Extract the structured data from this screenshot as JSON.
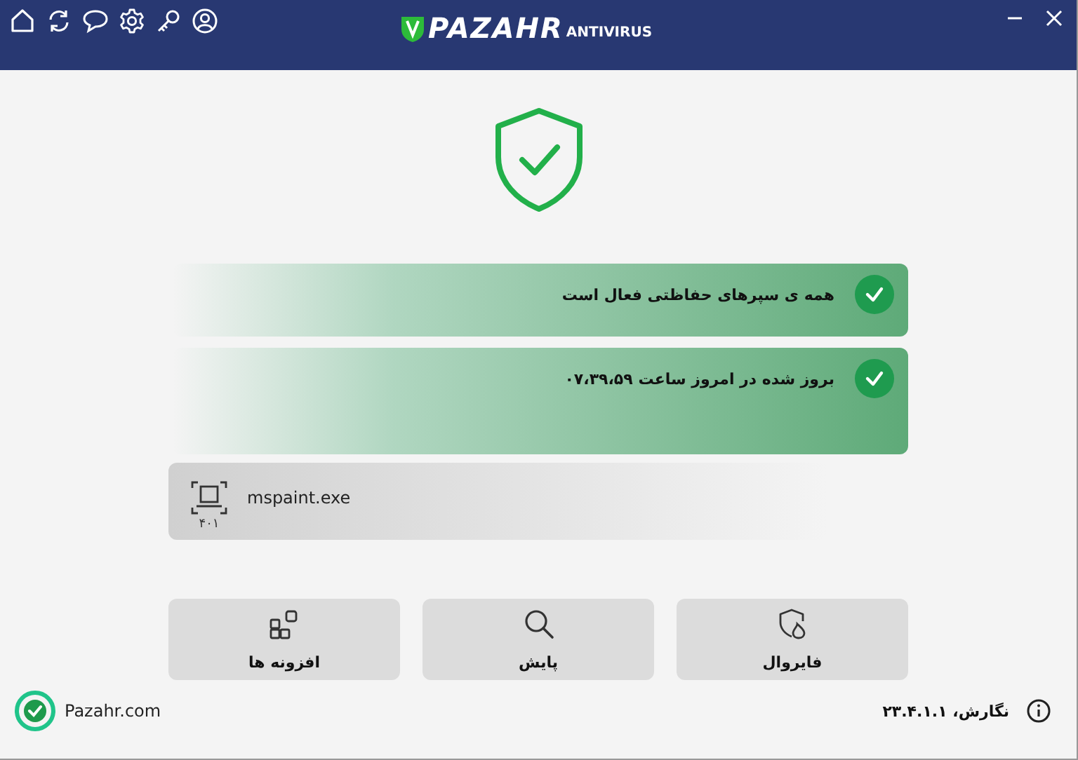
{
  "header": {
    "logo_main": "PAZAHR",
    "logo_sub": "ANTIVIRUS"
  },
  "status_items": [
    {
      "text": "همه ی سپرهای حفاظتی فعال است",
      "checked": true
    },
    {
      "text": "بروز شده در امروز  ساعت ۰۷،۳۹،۵۹",
      "checked": true
    }
  ],
  "process": {
    "name": "mspaint.exe",
    "count": "۴۰۱"
  },
  "actions": [
    {
      "kind": "firewall",
      "label": "فایروال"
    },
    {
      "kind": "scan",
      "label": "پایش"
    },
    {
      "kind": "addons",
      "label": "افزونه ها"
    }
  ],
  "footer": {
    "site": "Pazahr.com",
    "version": "نگارش، ۲۳.۴.۱.۱"
  }
}
